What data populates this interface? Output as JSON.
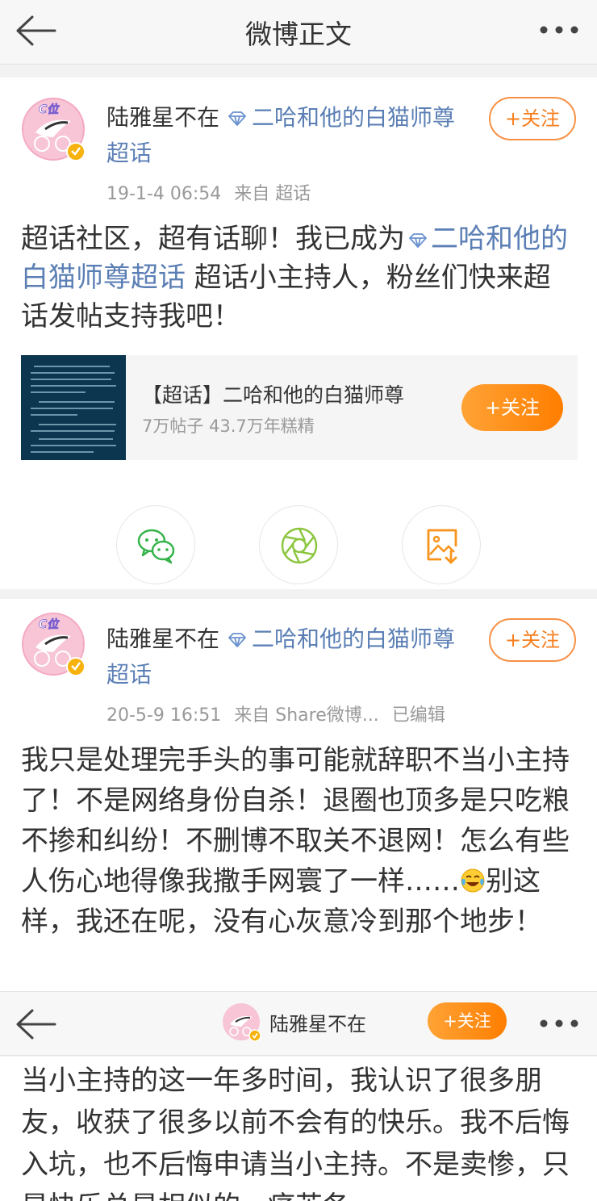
{
  "header": {
    "title": "微博正文"
  },
  "post1": {
    "user": {
      "name": "陆雅星不在",
      "avatar_badge": "C位"
    },
    "topic_link": "二哈和他的白猫师尊超话",
    "follow_label": "+关注",
    "meta": {
      "time": "19-1-4 06:54",
      "source": "来自 超话"
    },
    "body_prefix": "超话社区，超有话聊！我已成为",
    "body_link": "二哈和他的白猫师尊超话",
    "body_suffix": " 超话小主持人，粉丝们快来超话发帖支持我吧！",
    "topic_card": {
      "name": "【超话】二哈和他的白猫师尊",
      "stats": "7万帖子 43.7万年糕精",
      "follow_label": "+关注"
    }
  },
  "share": {
    "icons": [
      "wechat-icon",
      "moments-icon",
      "save-image-icon"
    ]
  },
  "post2": {
    "user": {
      "name": "陆雅星不在",
      "avatar_badge": "C位"
    },
    "topic_link": "二哈和他的白猫师尊超话",
    "follow_label": "+关注",
    "meta": {
      "time": "20-5-9 16:51",
      "source": "来自 Share微博...",
      "edited": "已编辑"
    },
    "body_part1": "我只是处理完手头的事可能就辞职不当小主持了！不是网络身份自杀！退圈也顶多是只吃粮不掺和纠纷！不删博不取关不退网！怎么有些人伤心地得像我撒手网寰了一样……",
    "body_part2": "别这样，我还在呢，没有心灰意冷到那个地步！"
  },
  "sticky_bar": {
    "name": "陆雅星不在",
    "follow_label": "+关注"
  },
  "continued_body": "当小主持的这一年多时间，我认识了很多朋友，收获了很多以前不会有的快乐。我不后悔入坑，也不后悔申请当小主持。不是卖惨，只是快乐总是相似的，痛苦各"
}
